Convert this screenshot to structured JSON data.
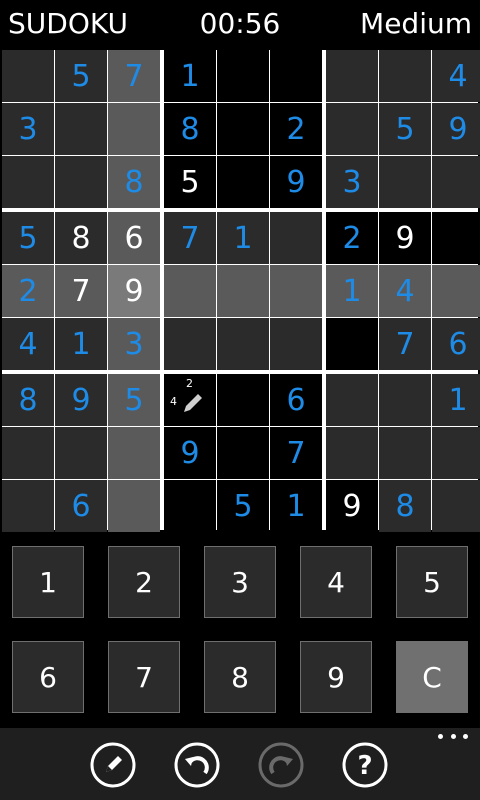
{
  "header": {
    "title": "SUDOKU",
    "timer": "00:56",
    "difficulty": "Medium"
  },
  "board": {
    "cells": [
      [
        "",
        "5",
        "7",
        "1",
        "",
        "",
        "",
        "",
        "4"
      ],
      [
        "3",
        "",
        "",
        "8",
        "",
        "2",
        "",
        "5",
        "9"
      ],
      [
        "",
        "",
        "8",
        "5",
        "",
        "9",
        "3",
        "",
        ""
      ],
      [
        "5",
        "8",
        "6",
        "7",
        "1",
        "",
        "2",
        "9",
        ""
      ],
      [
        "2",
        "7",
        "9",
        "",
        "",
        "",
        "1",
        "4",
        ""
      ],
      [
        "4",
        "1",
        "3",
        "",
        "",
        "",
        "",
        "7",
        "6"
      ],
      [
        "8",
        "9",
        "5",
        "",
        "",
        "6",
        "",
        "",
        "1"
      ],
      [
        "",
        "",
        "",
        "9",
        "",
        "7",
        "",
        "",
        ""
      ],
      [
        "",
        "6",
        "",
        "",
        "5",
        "1",
        "9",
        "8",
        ""
      ]
    ],
    "kinds": [
      [
        "",
        "e",
        "e",
        "e",
        "",
        "",
        "",
        "",
        "e"
      ],
      [
        "e",
        "",
        "",
        "e",
        "",
        "e",
        "",
        "e",
        "e"
      ],
      [
        "",
        "",
        "e",
        "g",
        "",
        "e",
        "e",
        "",
        ""
      ],
      [
        "e",
        "g",
        "g",
        "e",
        "e",
        "",
        "e",
        "g",
        ""
      ],
      [
        "e",
        "g",
        "g",
        "",
        "",
        "",
        "e",
        "e",
        ""
      ],
      [
        "e",
        "e",
        "e",
        "",
        "",
        "",
        "",
        "e",
        "e"
      ],
      [
        "e",
        "e",
        "e",
        "",
        "",
        "e",
        "",
        "",
        "e"
      ],
      [
        "",
        "",
        "",
        "e",
        "",
        "e",
        "",
        "",
        ""
      ],
      [
        "",
        "e",
        "",
        "",
        "e",
        "e",
        "g",
        "e",
        ""
      ]
    ],
    "selected": {
      "row": 4,
      "col": 2
    },
    "notes_cell": {
      "row": 6,
      "col": 3,
      "notes": [
        "4",
        "2"
      ]
    },
    "colors": {
      "cell": "#2b2b2b",
      "row_col_highlight": "#5a5a5a",
      "selected": "#7a7a7a",
      "black_cell": "#000000",
      "entry": "#1e8be6",
      "given": "#ffffff"
    }
  },
  "keypad": {
    "keys": [
      "1",
      "2",
      "3",
      "4",
      "5",
      "6",
      "7",
      "8",
      "9",
      "C"
    ]
  },
  "appbar": {
    "buttons": [
      "pencil-icon",
      "undo-icon",
      "redo-icon",
      "help-icon"
    ],
    "redo_disabled": true
  }
}
